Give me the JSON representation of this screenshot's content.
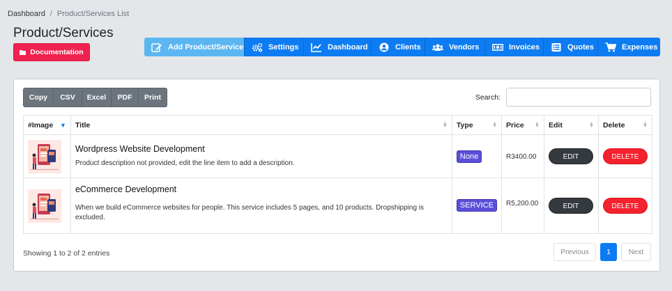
{
  "breadcrumb": {
    "root": "Dashboard",
    "separator": "/",
    "current": "Product/Services List"
  },
  "page_title": "Product/Services",
  "doc_button": {
    "label": "Documentation",
    "icon": "folder-icon"
  },
  "nav": [
    {
      "label": "Add Product/Service",
      "icon": "edit-icon"
    },
    {
      "label": "Settings",
      "icon": "cogs-icon"
    },
    {
      "label": "Dashboard",
      "icon": "chart-line-icon"
    },
    {
      "label": "Clients",
      "icon": "user-circle-icon"
    },
    {
      "label": "Vendors",
      "icon": "users-icon"
    },
    {
      "label": "Invoices",
      "icon": "money-bill-icon"
    },
    {
      "label": "Quotes",
      "icon": "list-alt-icon"
    },
    {
      "label": "Expenses",
      "icon": "shopping-cart-icon"
    }
  ],
  "export_buttons": [
    "Copy",
    "CSV",
    "Excel",
    "PDF",
    "Print"
  ],
  "search": {
    "label": "Search:",
    "value": ""
  },
  "table": {
    "columns": [
      "#Image",
      "Title",
      "Type",
      "Price",
      "Edit",
      "Delete"
    ],
    "rows": [
      {
        "title": "Wordpress Website Development",
        "description": "Product description not provided, edit the line item to add a description.",
        "type": "None",
        "price": "R3400.00",
        "edit": "EDIT",
        "delete": "DELETE"
      },
      {
        "title": "eCommerce Development",
        "description": "When we build eCommerce websites for people. This service includes 5 pages, and 10 products. Dropshipping is excluded.",
        "type": "SERVICE",
        "price": "R5,200.00",
        "edit": "EDIT",
        "delete": "DELETE"
      }
    ]
  },
  "footer": {
    "info": "Showing 1 to 2 of 2 entries",
    "previous": "Previous",
    "page": "1",
    "next": "Next"
  },
  "colors": {
    "primary": "#0d7cf2",
    "active_nav": "#5cb6f2",
    "danger": "#f5222d",
    "doc": "#f0224f",
    "badge": "#5a4fd8"
  }
}
